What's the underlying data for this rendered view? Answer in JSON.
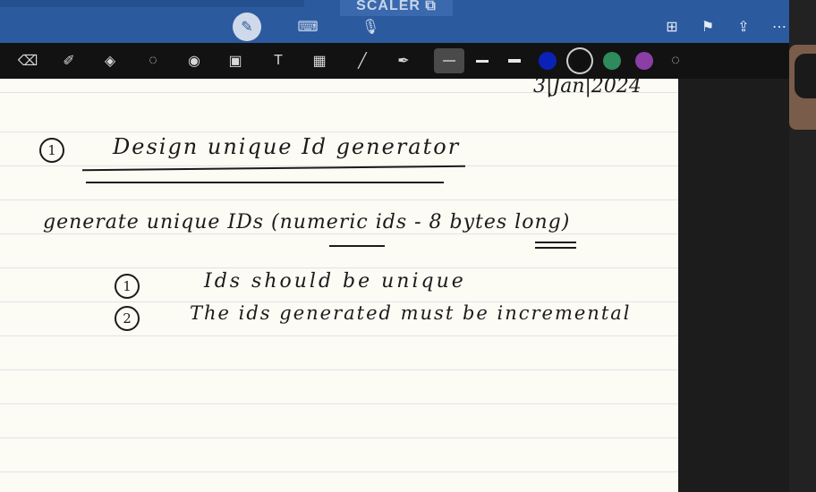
{
  "app": {
    "brand": "SCALER"
  },
  "top_toolbar": {
    "modes": [
      {
        "name": "pen-mode",
        "icon": "pen-icon",
        "active": true
      },
      {
        "name": "keyboard-mode",
        "icon": "keyboard-icon",
        "active": false
      },
      {
        "name": "audio-mode",
        "icon": "microphone-icon",
        "active": false
      }
    ],
    "right_actions": [
      "add-page-icon",
      "bookmark-icon",
      "share-icon",
      "more-icon"
    ]
  },
  "drawing_tools": {
    "tools": [
      "eraser-icon",
      "highlighter-icon",
      "shapes-icon",
      "lasso-icon",
      "laser-pointer-icon",
      "image-icon",
      "text-icon",
      "sticker-icon",
      "ruler-icon",
      "color-picker-icon"
    ],
    "stroke_widths": [
      "thin",
      "medium",
      "thick"
    ],
    "selected_stroke": "thin",
    "colors": [
      "#0b22b8",
      "#101010",
      "#2f8a5c",
      "#8b3fa6"
    ],
    "selected_color": "#101010"
  },
  "notes": {
    "date": "3|Jan|2024",
    "heading_number": "1",
    "heading": "Design unique Id generator",
    "line1": "generate unique IDs (numeric ids - 8 bytes long)",
    "items": [
      {
        "number": "1",
        "text": "Ids should be unique"
      },
      {
        "number": "2",
        "text": "The ids generated must be incremental"
      }
    ]
  }
}
